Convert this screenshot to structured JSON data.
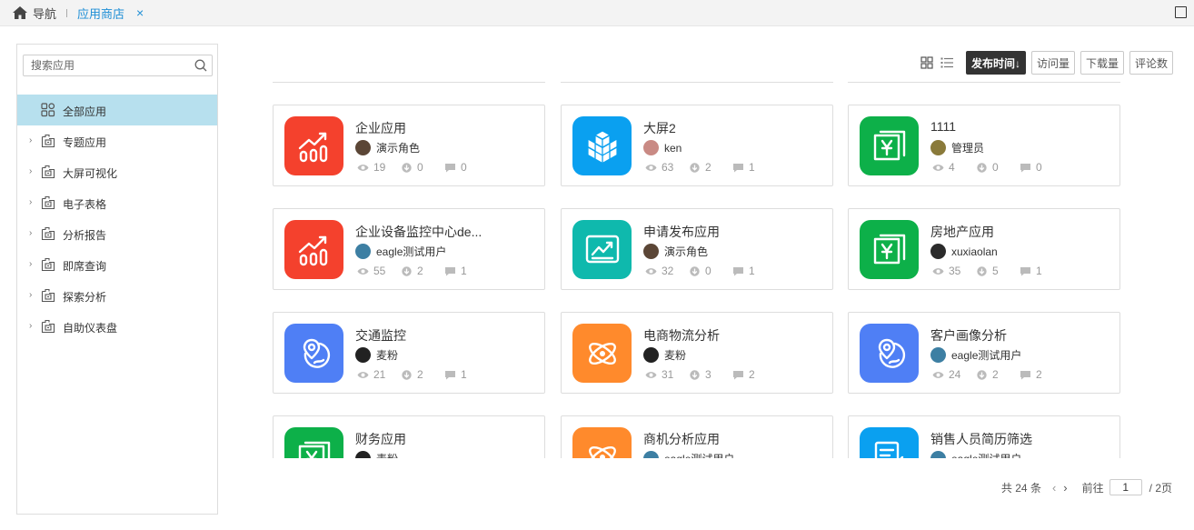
{
  "topbar": {
    "home_label": "导航",
    "active_tab": "应用商店",
    "close_glyph": "×"
  },
  "sidebar": {
    "search_placeholder": "搜索应用",
    "items": [
      {
        "label": "全部应用",
        "icon": "grid-apps-icon",
        "active": true
      },
      {
        "label": "专题应用",
        "icon": "folder-icon"
      },
      {
        "label": "大屏可视化",
        "icon": "folder-icon"
      },
      {
        "label": "电子表格",
        "icon": "folder-icon"
      },
      {
        "label": "分析报告",
        "icon": "folder-icon"
      },
      {
        "label": "即席查询",
        "icon": "folder-icon"
      },
      {
        "label": "探索分析",
        "icon": "folder-icon"
      },
      {
        "label": "自助仪表盘",
        "icon": "folder-icon"
      }
    ]
  },
  "toolbar": {
    "sort_buttons": [
      "发布时间↓",
      "访问量",
      "下载量",
      "评论数"
    ],
    "active_sort": "发布时间↓",
    "view_icons": [
      "grid-view-icon",
      "list-view-icon"
    ]
  },
  "cards": [
    {
      "title": "企业应用",
      "owner": "演示角色",
      "views": "19",
      "downloads": "0",
      "comments": "0",
      "icon": "bar-chart-up-icon",
      "color": "#f4412d",
      "avatar_color": "#5b4636"
    },
    {
      "title": "大屏2",
      "owner": "ken",
      "views": "63",
      "downloads": "2",
      "comments": "1",
      "icon": "cubes-icon",
      "color": "#0aa0f0",
      "avatar_color": "#c98a84"
    },
    {
      "title": "1111",
      "owner": "管理员",
      "views": "4",
      "downloads": "0",
      "comments": "0",
      "icon": "yen-doc-icon",
      "color": "#0db049",
      "avatar_color": "#8a7a3a"
    },
    {
      "title": "企业设备监控中心de...",
      "owner": "eagle测试用户",
      "views": "55",
      "downloads": "2",
      "comments": "1",
      "icon": "bar-chart-up-icon",
      "color": "#f4412d",
      "avatar_color": "#3d7fa3"
    },
    {
      "title": "申请发布应用",
      "owner": "演示角色",
      "views": "32",
      "downloads": "0",
      "comments": "1",
      "icon": "line-chart-icon",
      "color": "#0fb9ad",
      "avatar_color": "#5b4636"
    },
    {
      "title": "房地产应用",
      "owner": "xuxiaolan",
      "views": "35",
      "downloads": "5",
      "comments": "1",
      "icon": "yen-doc-icon",
      "color": "#0db049",
      "avatar_color": "#2b2b2b"
    },
    {
      "title": "交通监控",
      "owner": "麦粉",
      "views": "21",
      "downloads": "2",
      "comments": "1",
      "icon": "map-pin-globe-icon",
      "color": "#4f7ff5",
      "avatar_color": "#222222"
    },
    {
      "title": "电商物流分析",
      "owner": "麦粉",
      "views": "31",
      "downloads": "3",
      "comments": "2",
      "icon": "atom-icon",
      "color": "#ff8a2c",
      "avatar_color": "#222222"
    },
    {
      "title": "客户画像分析",
      "owner": "eagle测试用户",
      "views": "24",
      "downloads": "2",
      "comments": "2",
      "icon": "map-pin-globe-icon",
      "color": "#4f7ff5",
      "avatar_color": "#3d7fa3"
    },
    {
      "title": "财务应用",
      "owner": "麦粉",
      "views": "",
      "downloads": "",
      "comments": "",
      "icon": "yen-doc-icon",
      "color": "#0db049",
      "avatar_color": "#222222"
    },
    {
      "title": "商机分析应用",
      "owner": "eagle测试用户",
      "views": "",
      "downloads": "",
      "comments": "",
      "icon": "atom-icon",
      "color": "#ff8a2c",
      "avatar_color": "#3d7fa3"
    },
    {
      "title": "销售人员简历筛选",
      "owner": "eagle测试用户",
      "views": "",
      "downloads": "",
      "comments": "",
      "icon": "resume-doc-icon",
      "color": "#0aa0f0",
      "avatar_color": "#3d7fa3"
    }
  ],
  "pagination": {
    "total": "共 24 条",
    "prev": "‹",
    "next": "›",
    "goto_label": "前往",
    "current_page": "1",
    "total_pages": "/ 2页"
  }
}
